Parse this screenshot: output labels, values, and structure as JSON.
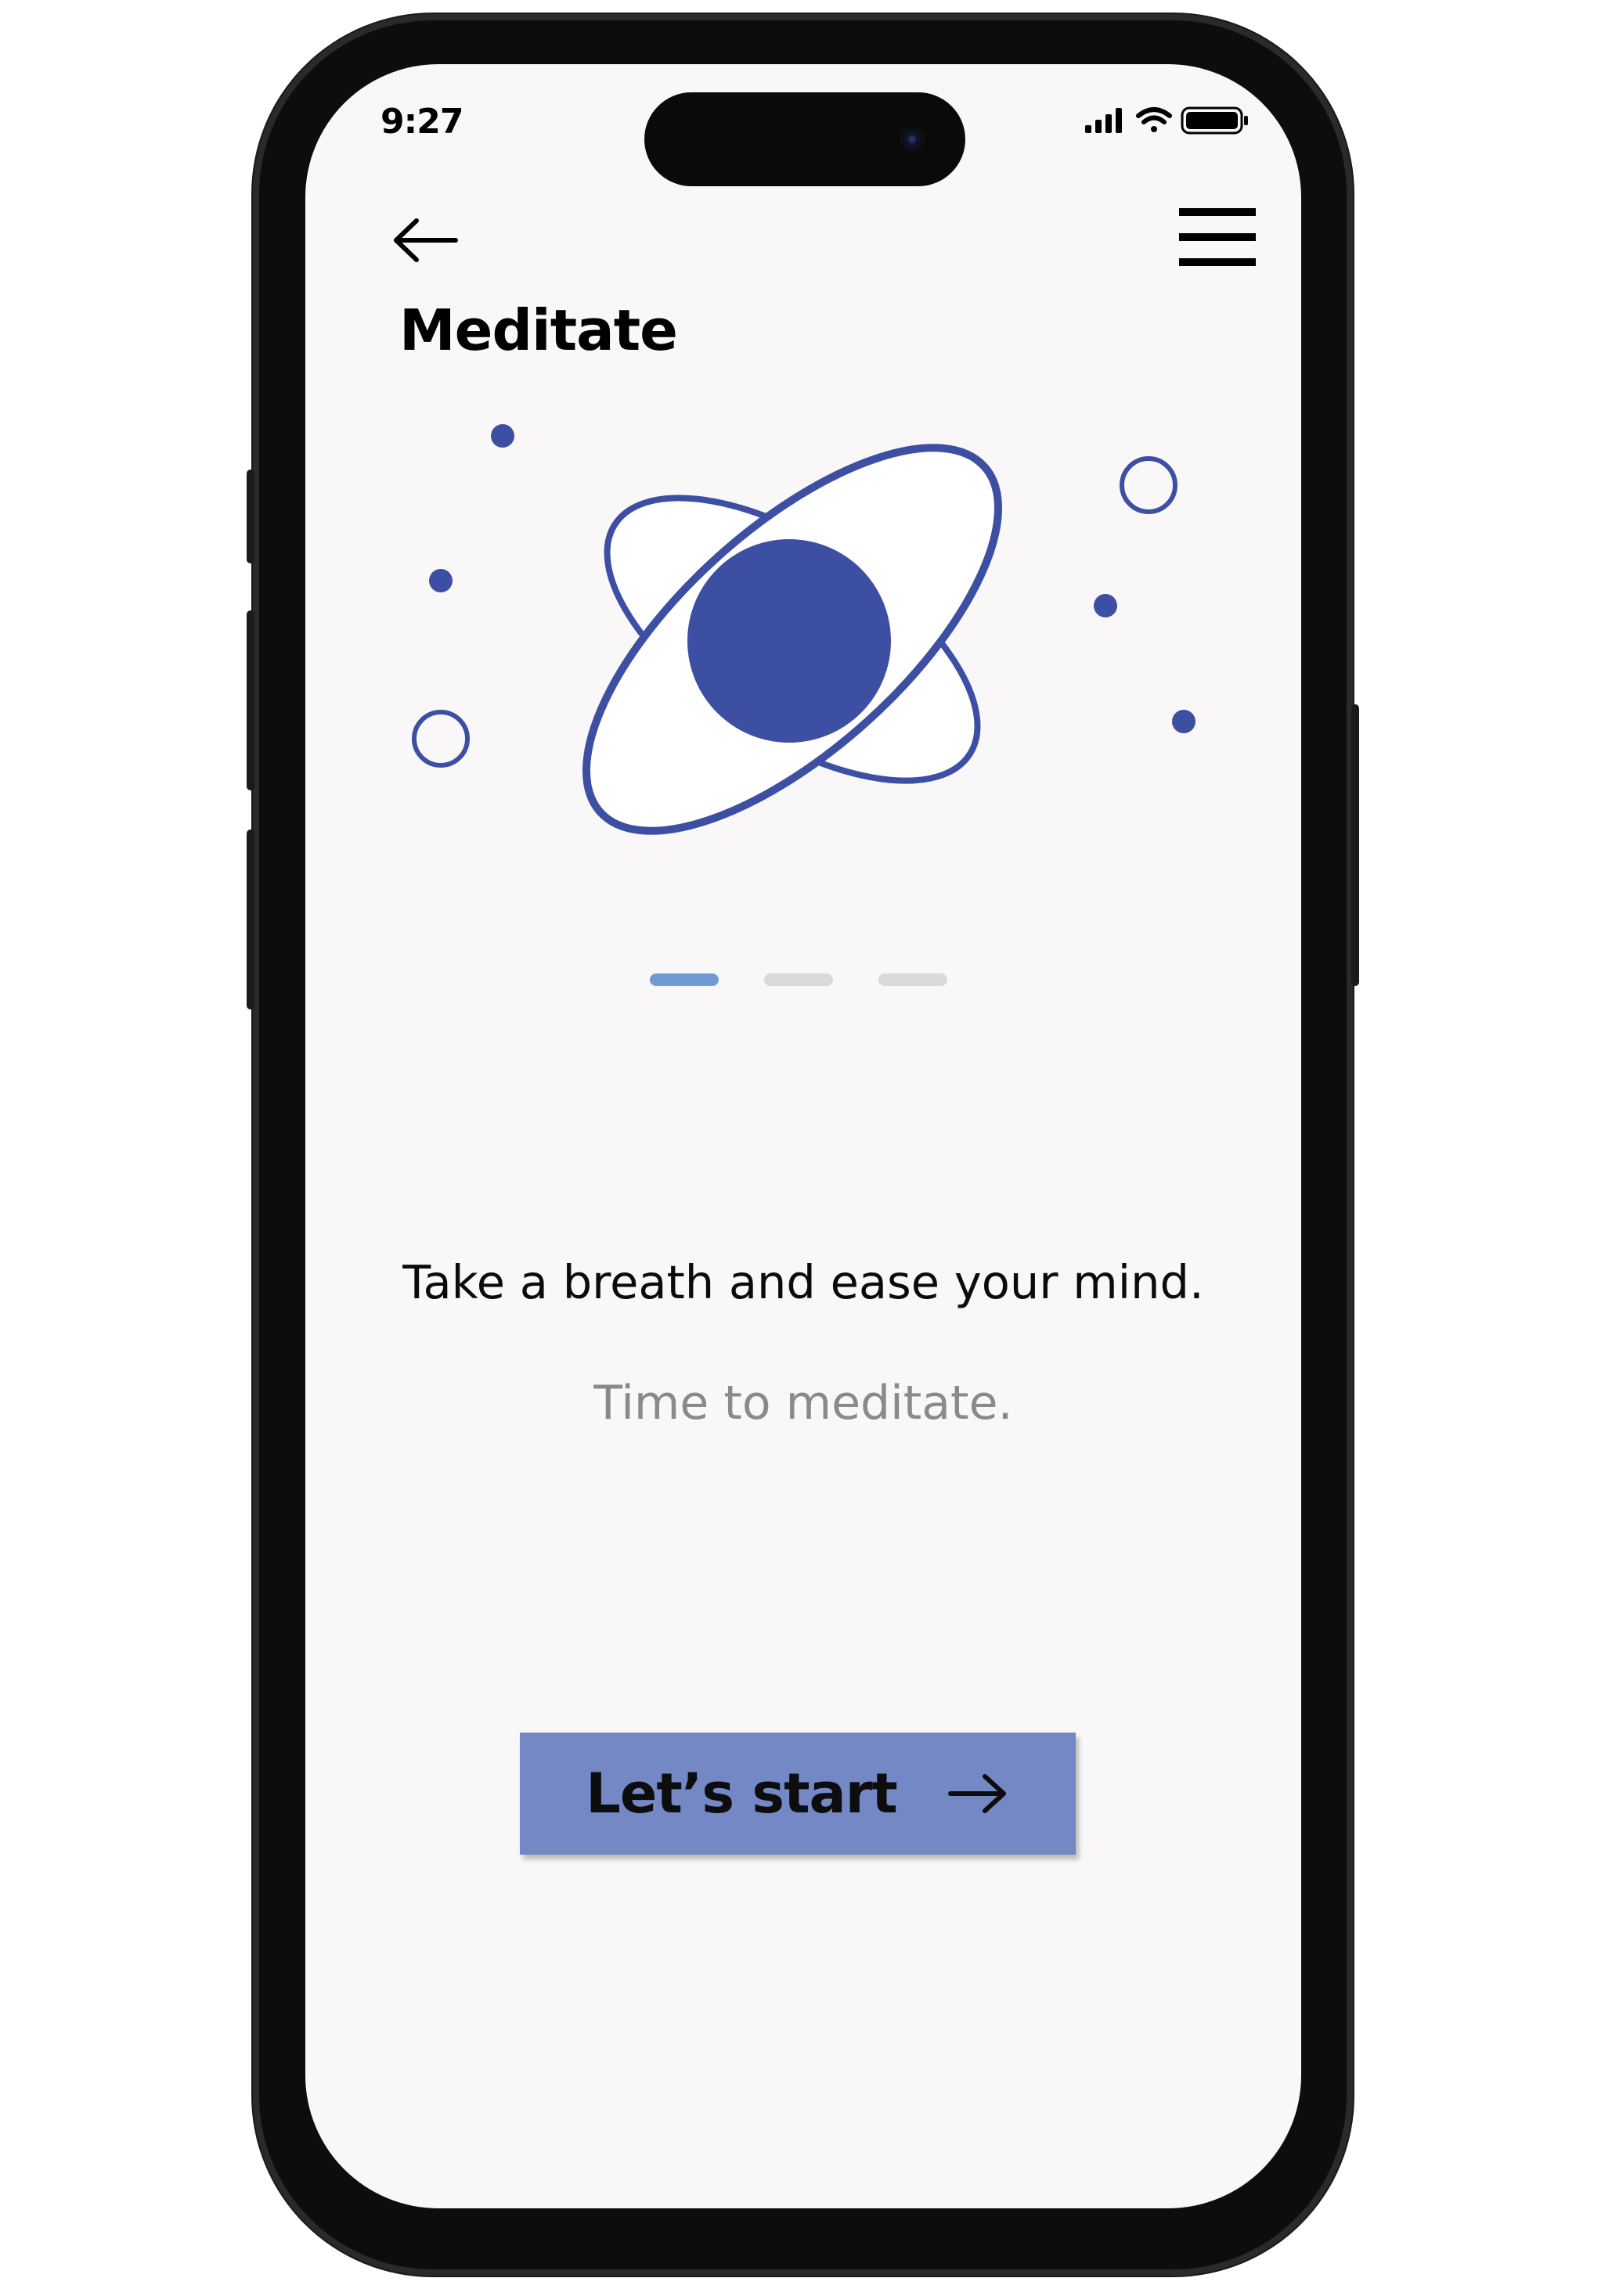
{
  "status_bar": {
    "time": "9:27",
    "icons": [
      "cellular-signal-icon",
      "wifi-icon",
      "battery-icon"
    ]
  },
  "header": {
    "back_icon": "arrow-left-icon",
    "menu_icon": "hamburger-menu-icon",
    "title": "Meditate"
  },
  "illustration": {
    "icon": "atom-orbit-illustration",
    "accent_color": "#3d4fa3"
  },
  "pager": {
    "total": 3,
    "active_index": 0,
    "active_color": "#6f9ad6",
    "inactive_color": "#d9d9d9"
  },
  "content": {
    "headline": "Take a breath and ease your mind.",
    "subline": "Time to meditate."
  },
  "cta": {
    "label": "Let’s start",
    "icon": "arrow-right-icon",
    "color": "#7388c5"
  }
}
